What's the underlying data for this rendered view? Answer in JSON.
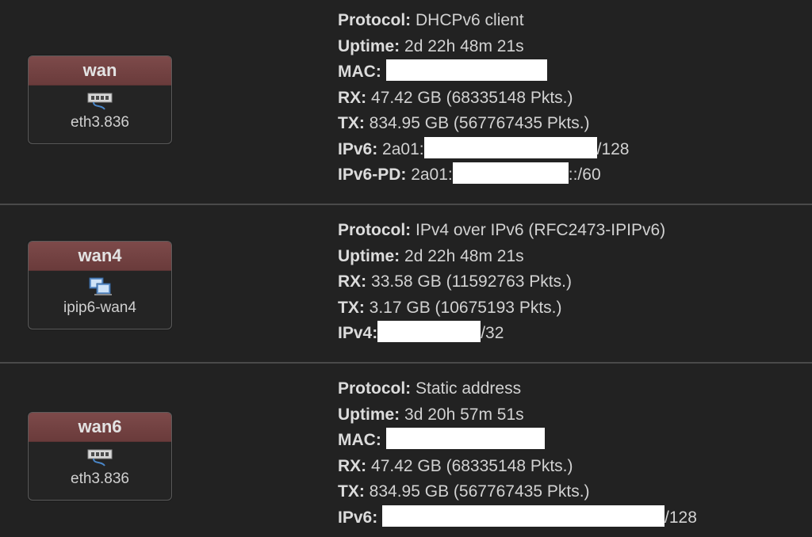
{
  "interfaces": [
    {
      "name": "wan",
      "device": "eth3.836",
      "icon": "ethernet-port-icon",
      "lines": [
        {
          "key": "Protocol:",
          "value": "DHCPv6 client"
        },
        {
          "key": "Uptime:",
          "value": "2d 22h 48m 21s"
        },
        {
          "key": "MAC:",
          "value": "",
          "redacted": true
        },
        {
          "key": "RX:",
          "value": "47.42 GB (68335148 Pkts.)"
        },
        {
          "key": "TX:",
          "value": "834.95 GB (567767435 Pkts.)"
        },
        {
          "key": "IPv6:",
          "prefix": "2a01:",
          "suffix": "/128",
          "redacted": true
        },
        {
          "key": "IPv6-PD:",
          "prefix": "2a01:",
          "suffix": "::/60",
          "redacted": true
        }
      ]
    },
    {
      "name": "wan4",
      "device": "ipip6-wan4",
      "icon": "tunnel-network-icon",
      "lines": [
        {
          "key": "Protocol:",
          "value": "IPv4 over IPv6 (RFC2473-IPIPv6)"
        },
        {
          "key": "Uptime:",
          "value": "2d 22h 48m 21s"
        },
        {
          "key": "RX:",
          "value": "33.58 GB (11592763 Pkts.)"
        },
        {
          "key": "TX:",
          "value": "3.17 GB (10675193 Pkts.)"
        },
        {
          "key": "IPv4:",
          "suffix": "/32",
          "redacted": true
        }
      ]
    },
    {
      "name": "wan6",
      "device": "eth3.836",
      "icon": "ethernet-port-icon",
      "lines": [
        {
          "key": "Protocol:",
          "value": "Static address"
        },
        {
          "key": "Uptime:",
          "value": "3d 20h 57m 51s"
        },
        {
          "key": "MAC:",
          "value": "",
          "redacted": true
        },
        {
          "key": "RX:",
          "value": "47.42 GB (68335148 Pkts.)"
        },
        {
          "key": "TX:",
          "value": "834.95 GB (567767435 Pkts.)"
        },
        {
          "key": "IPv6:",
          "suffix": "/128",
          "redacted": true
        }
      ]
    }
  ],
  "colors": {
    "background": "#222222",
    "badge_header": "#724141",
    "divider": "#4a4a4a",
    "redaction": "#ffffff"
  }
}
